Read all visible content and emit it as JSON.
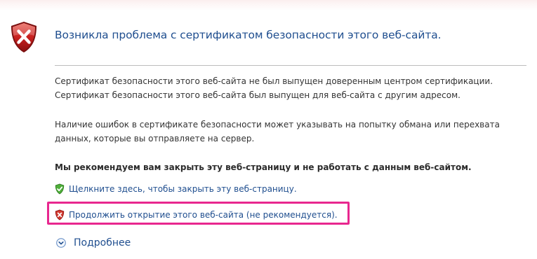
{
  "header": {
    "title": "Возникла проблема с сертификатом безопасности этого веб-сайта.",
    "icon": "error-shield-icon"
  },
  "body": {
    "paragraph1_line1": "Сертификат безопасности этого веб-сайта не был выпущен доверенным центром сертификации.",
    "paragraph1_line2": "Сертификат безопасности этого веб-сайта был выпущен для веб-сайта с другим адресом.",
    "paragraph2_line1": "Наличие ошибок в сертификате безопасности может указывать на попытку обмана или перехвата",
    "paragraph2_line2": "данных, которые вы отправляете на сервер.",
    "recommendation": "Мы рекомендуем вам закрыть эту веб-страницу и не работать с данным веб-сайтом."
  },
  "actions": {
    "close_link": "Щелкните здесь, чтобы закрыть эту веб-страницу.",
    "close_icon": "green-check-shield-icon",
    "continue_link": "Продолжить открытие этого веб-сайта (не рекомендуется).",
    "continue_icon": "red-x-shield-icon",
    "more_info": "Подробнее",
    "more_icon": "chevron-down-circle-icon"
  },
  "colors": {
    "title": "#1f4e8f",
    "link": "#1f4e8f",
    "highlight_border": "#e8278f",
    "error_red": "#c8201f",
    "ok_green": "#3f9a2f"
  }
}
